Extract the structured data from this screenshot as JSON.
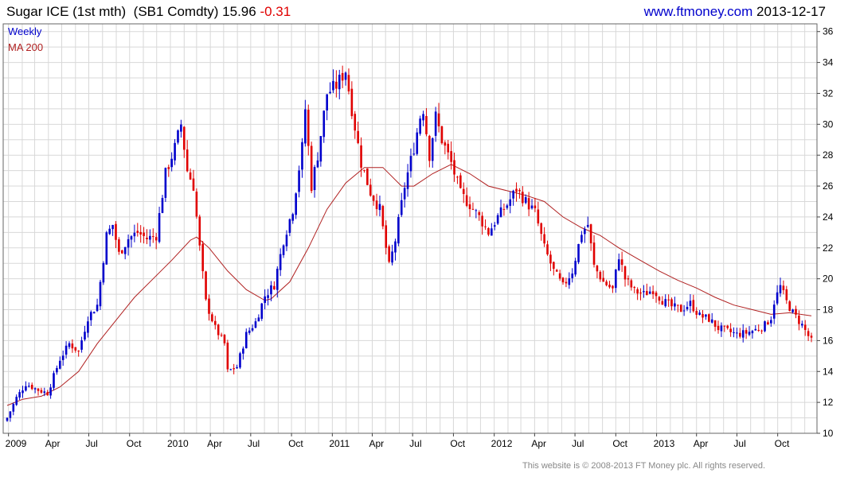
{
  "header": {
    "title": "Sugar ICE (1st mth)",
    "ticker": "(SB1 Comdty)",
    "price": "15.96",
    "change": "-0.31",
    "site": "www.ftmoney.com",
    "date": "2013-12-17"
  },
  "footer": {
    "copyright": "This website is © 2008-2013 FT Money plc. All rights reserved."
  },
  "colors": {
    "up": "#0000cc",
    "down": "#e00000",
    "ma": "#b02020",
    "grid": "#d8d8d8"
  },
  "chart_data": {
    "type": "candlestick",
    "legend": [
      {
        "name": "Weekly",
        "color": "#0000cc"
      },
      {
        "name": "MA 200",
        "color": "#b02020"
      }
    ],
    "y_axis": {
      "min": 10,
      "max": 36.5,
      "ticks": [
        10,
        12,
        14,
        16,
        18,
        20,
        22,
        24,
        26,
        28,
        30,
        32,
        34,
        36
      ],
      "position": "right"
    },
    "x_axis": {
      "start": "2008-12-29",
      "end": "2013-12-16",
      "ticks": [
        {
          "date": "2009-01-01",
          "label": "2009"
        },
        {
          "date": "2009-04-01",
          "label": "Apr"
        },
        {
          "date": "2009-07-01",
          "label": "Jul"
        },
        {
          "date": "2009-10-01",
          "label": "Oct"
        },
        {
          "date": "2010-01-01",
          "label": "2010"
        },
        {
          "date": "2010-04-01",
          "label": "Apr"
        },
        {
          "date": "2010-07-01",
          "label": "Jul"
        },
        {
          "date": "2010-10-01",
          "label": "Oct"
        },
        {
          "date": "2011-01-01",
          "label": "2011"
        },
        {
          "date": "2011-04-01",
          "label": "Apr"
        },
        {
          "date": "2011-07-01",
          "label": "Jul"
        },
        {
          "date": "2011-10-01",
          "label": "Oct"
        },
        {
          "date": "2012-01-01",
          "label": "2012"
        },
        {
          "date": "2012-04-01",
          "label": "Apr"
        },
        {
          "date": "2012-07-01",
          "label": "Jul"
        },
        {
          "date": "2012-10-01",
          "label": "Oct"
        },
        {
          "date": "2013-01-01",
          "label": "2013"
        },
        {
          "date": "2013-04-01",
          "label": "Apr"
        },
        {
          "date": "2013-07-01",
          "label": "Jul"
        },
        {
          "date": "2013-10-01",
          "label": "Oct"
        }
      ]
    },
    "close_path": [
      [
        "2008-12-29",
        11.0
      ],
      [
        "2009-01-19",
        12.3
      ],
      [
        "2009-02-09",
        13.2
      ],
      [
        "2009-03-09",
        12.8
      ],
      [
        "2009-03-30",
        12.6
      ],
      [
        "2009-04-27",
        14.8
      ],
      [
        "2009-05-18",
        15.8
      ],
      [
        "2009-06-08",
        15.3
      ],
      [
        "2009-06-29",
        17.5
      ],
      [
        "2009-07-20",
        18.3
      ],
      [
        "2009-08-10",
        22.8
      ],
      [
        "2009-08-24",
        23.5
      ],
      [
        "2009-09-07",
        21.6
      ],
      [
        "2009-09-28",
        22.6
      ],
      [
        "2009-10-19",
        23.0
      ],
      [
        "2009-11-09",
        22.6
      ],
      [
        "2009-11-30",
        22.8
      ],
      [
        "2009-12-21",
        26.8
      ],
      [
        "2010-01-11",
        28.5
      ],
      [
        "2010-01-25",
        30.0
      ],
      [
        "2010-02-08",
        27.0
      ],
      [
        "2010-02-22",
        26.0
      ],
      [
        "2010-03-08",
        22.0
      ],
      [
        "2010-03-22",
        18.5
      ],
      [
        "2010-04-12",
        16.8
      ],
      [
        "2010-05-03",
        15.8
      ],
      [
        "2010-05-10",
        14.0
      ],
      [
        "2010-05-31",
        14.3
      ],
      [
        "2010-06-21",
        16.4
      ],
      [
        "2010-07-12",
        17.2
      ],
      [
        "2010-08-02",
        18.9
      ],
      [
        "2010-08-23",
        19.6
      ],
      [
        "2010-09-13",
        22.5
      ],
      [
        "2010-10-04",
        24.5
      ],
      [
        "2010-10-25",
        28.5
      ],
      [
        "2010-11-01",
        31.0
      ],
      [
        "2010-11-15",
        26.0
      ],
      [
        "2010-11-29",
        28.0
      ],
      [
        "2010-12-20",
        32.0
      ],
      [
        "2011-01-10",
        32.5
      ],
      [
        "2011-01-31",
        33.5
      ],
      [
        "2011-02-14",
        31.0
      ],
      [
        "2011-03-07",
        27.5
      ],
      [
        "2011-03-28",
        25.6
      ],
      [
        "2011-04-18",
        24.5
      ],
      [
        "2011-05-02",
        22.0
      ],
      [
        "2011-05-09",
        20.8
      ],
      [
        "2011-05-23",
        22.5
      ],
      [
        "2011-06-13",
        26.0
      ],
      [
        "2011-07-04",
        28.5
      ],
      [
        "2011-07-18",
        30.5
      ],
      [
        "2011-07-25",
        31.0
      ],
      [
        "2011-08-08",
        28.0
      ],
      [
        "2011-08-22",
        30.5
      ],
      [
        "2011-09-05",
        29.0
      ],
      [
        "2011-09-26",
        27.5
      ],
      [
        "2011-10-17",
        25.5
      ],
      [
        "2011-11-07",
        24.8
      ],
      [
        "2011-11-28",
        24.0
      ],
      [
        "2011-12-19",
        23.0
      ],
      [
        "2012-01-09",
        24.0
      ],
      [
        "2012-01-30",
        24.8
      ],
      [
        "2012-02-20",
        25.8
      ],
      [
        "2012-03-12",
        25.0
      ],
      [
        "2012-04-02",
        24.3
      ],
      [
        "2012-04-23",
        22.0
      ],
      [
        "2012-05-14",
        20.5
      ],
      [
        "2012-06-04",
        19.5
      ],
      [
        "2012-06-25",
        20.5
      ],
      [
        "2012-07-16",
        23.0
      ],
      [
        "2012-07-30",
        23.5
      ],
      [
        "2012-08-13",
        20.8
      ],
      [
        "2012-09-03",
        19.8
      ],
      [
        "2012-09-24",
        19.3
      ],
      [
        "2012-10-08",
        21.5
      ],
      [
        "2012-10-22",
        20.0
      ],
      [
        "2012-11-12",
        19.2
      ],
      [
        "2012-12-03",
        19.0
      ],
      [
        "2012-12-24",
        19.3
      ],
      [
        "2013-01-14",
        18.6
      ],
      [
        "2013-02-04",
        18.2
      ],
      [
        "2013-02-25",
        18.0
      ],
      [
        "2013-03-18",
        18.4
      ],
      [
        "2013-04-08",
        17.6
      ],
      [
        "2013-04-29",
        17.4
      ],
      [
        "2013-05-20",
        16.8
      ],
      [
        "2013-06-10",
        16.6
      ],
      [
        "2013-07-01",
        16.4
      ],
      [
        "2013-07-22",
        16.5
      ],
      [
        "2013-08-12",
        16.7
      ],
      [
        "2013-09-02",
        17.0
      ],
      [
        "2013-09-16",
        17.5
      ],
      [
        "2013-09-23",
        18.5
      ],
      [
        "2013-10-07",
        19.5
      ],
      [
        "2013-10-21",
        18.5
      ],
      [
        "2013-11-04",
        17.8
      ],
      [
        "2013-11-25",
        17.0
      ],
      [
        "2013-12-09",
        16.3
      ],
      [
        "2013-12-16",
        15.96
      ]
    ],
    "ma200": [
      [
        "2008-12-29",
        11.8
      ],
      [
        "2009-02-02",
        12.2
      ],
      [
        "2009-03-16",
        12.4
      ],
      [
        "2009-04-27",
        13.0
      ],
      [
        "2009-06-08",
        14.0
      ],
      [
        "2009-07-20",
        15.8
      ],
      [
        "2009-08-31",
        17.3
      ],
      [
        "2009-10-12",
        18.8
      ],
      [
        "2009-11-23",
        20.0
      ],
      [
        "2010-01-04",
        21.2
      ],
      [
        "2010-02-15",
        22.5
      ],
      [
        "2010-03-01",
        22.7
      ],
      [
        "2010-03-29",
        22.0
      ],
      [
        "2010-05-10",
        20.5
      ],
      [
        "2010-06-21",
        19.3
      ],
      [
        "2010-08-02",
        18.6
      ],
      [
        "2010-08-16",
        18.7
      ],
      [
        "2010-09-27",
        19.8
      ],
      [
        "2010-11-08",
        22.0
      ],
      [
        "2010-12-20",
        24.5
      ],
      [
        "2011-01-31",
        26.2
      ],
      [
        "2011-03-14",
        27.2
      ],
      [
        "2011-04-25",
        27.2
      ],
      [
        "2011-06-06",
        26.0
      ],
      [
        "2011-07-04",
        26.0
      ],
      [
        "2011-08-15",
        26.8
      ],
      [
        "2011-09-26",
        27.4
      ],
      [
        "2011-11-07",
        26.8
      ],
      [
        "2011-12-19",
        26.0
      ],
      [
        "2012-01-30",
        25.7
      ],
      [
        "2012-03-12",
        25.4
      ],
      [
        "2012-04-23",
        25.0
      ],
      [
        "2012-06-04",
        24.0
      ],
      [
        "2012-07-16",
        23.3
      ],
      [
        "2012-08-27",
        22.8
      ],
      [
        "2012-10-08",
        22.0
      ],
      [
        "2012-11-19",
        21.3
      ],
      [
        "2013-01-07",
        20.5
      ],
      [
        "2013-02-18",
        19.9
      ],
      [
        "2013-04-01",
        19.4
      ],
      [
        "2013-05-13",
        18.8
      ],
      [
        "2013-06-24",
        18.3
      ],
      [
        "2013-08-05",
        18.0
      ],
      [
        "2013-09-16",
        17.7
      ],
      [
        "2013-10-28",
        17.8
      ],
      [
        "2013-12-16",
        17.6
      ]
    ]
  }
}
